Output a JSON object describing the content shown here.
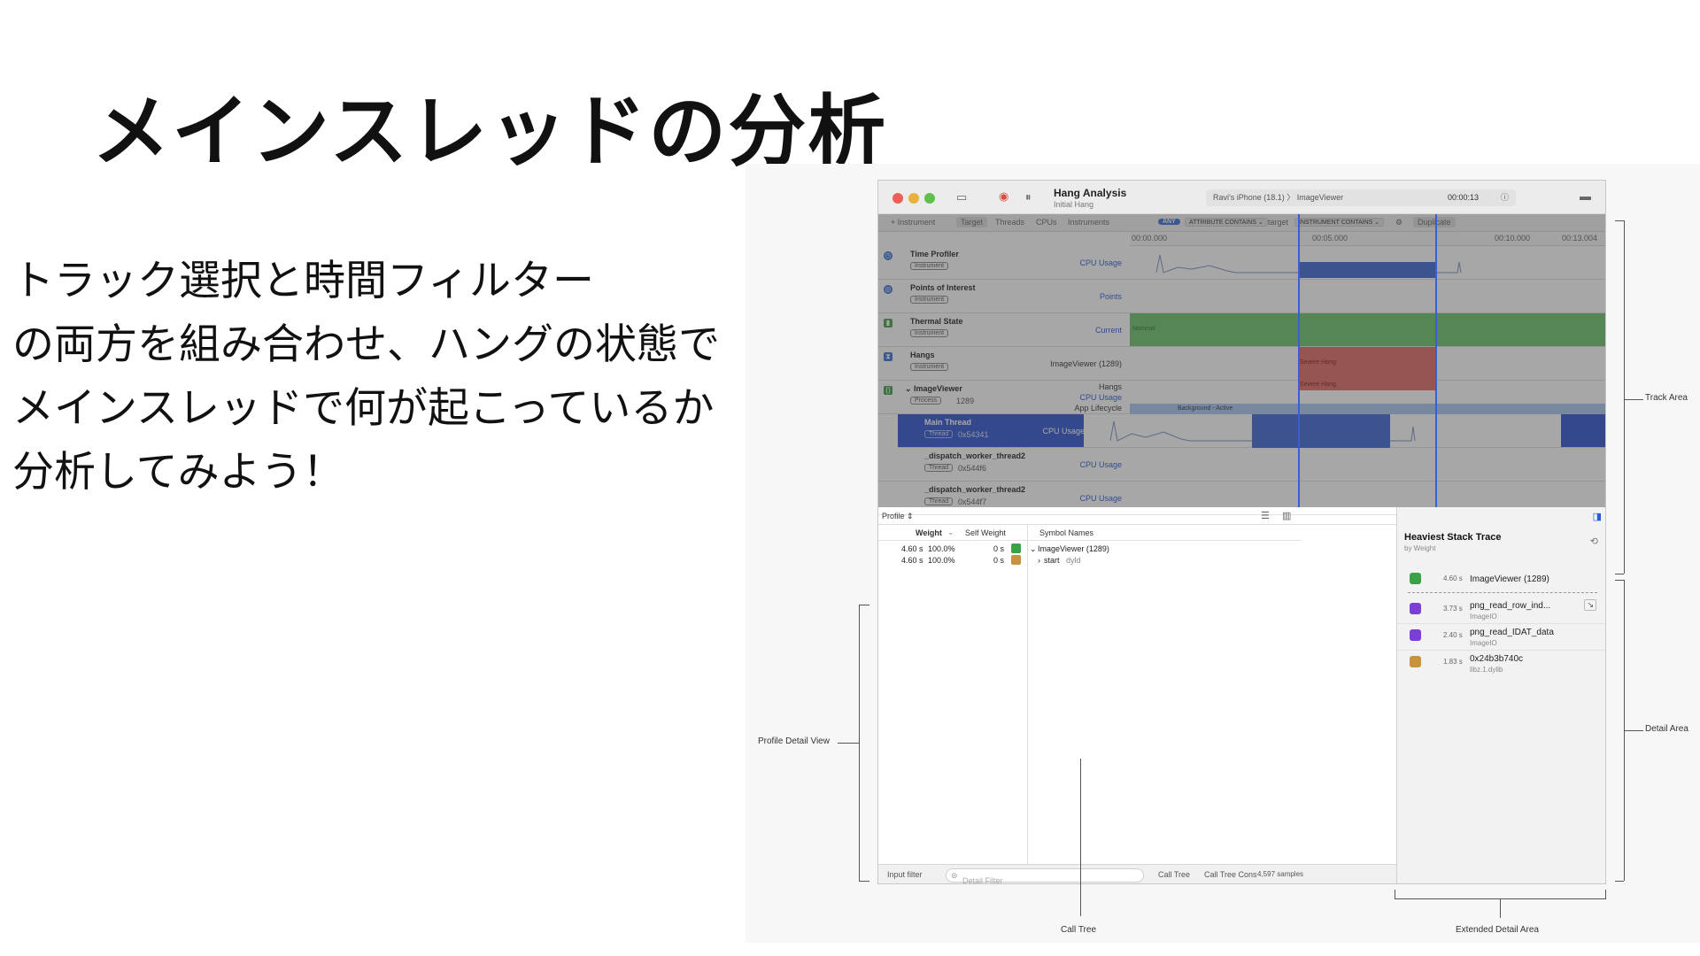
{
  "slide": {
    "title": "メインスレッドの分析",
    "body_lines": [
      "トラック選択と時間フィルター",
      "の両方を組み合わせ、ハングの状態で",
      "メインスレッドで何が起こっているか",
      "分析してみよう！"
    ]
  },
  "window": {
    "title": "Hang Analysis",
    "subtitle": "Initial Hang",
    "device": "Ravi's iPhone (18.1) 〉 ImageViewer",
    "elapsed": "00:00:13",
    "info_icon": "info-icon",
    "toolbar": {
      "add_instrument": "+ Instrument",
      "tabs": [
        "Target",
        "Threads",
        "CPUs",
        "Instruments"
      ],
      "filter_any": "ANY",
      "filter_attr": "ATTRIBUTE CONTAINS ⌄",
      "filter_target": "target",
      "filter_instr": "INSTRUMENT CONTAINS ⌄",
      "duplicate": "Duplicate"
    },
    "ruler": [
      "00:00.000",
      "00:05.000",
      "00:10.000",
      "00:13.004"
    ],
    "tracks": [
      {
        "name": "Time Profiler",
        "badge": "Instrument",
        "right": "CPU Usage"
      },
      {
        "name": "Points of Interest",
        "badge": "Instrument",
        "right": "Points"
      },
      {
        "name": "Thermal State",
        "badge": "Instrument",
        "right": "Current",
        "seg": "Nominal"
      },
      {
        "name": "Hangs",
        "badge": "Instrument",
        "right": "ImageViewer (1289)",
        "seg": "Severe Hang"
      },
      {
        "name": "ImageViewer",
        "badge": "Process",
        "pid": "1289",
        "right1": "Hangs",
        "right2": "CPU Usage",
        "right3": "App Lifecycle",
        "seg": "Severe Hang",
        "seg2": "Background - Active"
      },
      {
        "name": "Main Thread",
        "badge": "Thread",
        "pid": "0x54341",
        "right": "CPU Usage"
      },
      {
        "name": "_dispatch_worker_thread2",
        "badge": "Thread",
        "pid": "0x544f6",
        "right": "CPU Usage"
      },
      {
        "name": "_dispatch_worker_thread2",
        "badge": "Thread",
        "pid": "0x544f7",
        "right": "CPU Usage"
      }
    ],
    "profile": {
      "selector": "Profile ⇕",
      "columns": {
        "weight": "Weight",
        "self_weight": "Self Weight",
        "symbol": "Symbol Names"
      },
      "rows": [
        {
          "weight": "4.60 s",
          "pct": "100.0%",
          "self": "0 s",
          "symbol": "ImageViewer (1289)",
          "lib": ""
        },
        {
          "weight": "4.60 s",
          "pct": "100.0%",
          "self": "0 s",
          "symbol": "start",
          "lib": "dyld"
        }
      ],
      "footer": {
        "input_filter": "Input filter",
        "detail_filter_placeholder": "Detail Filter",
        "call_tree": "Call Tree",
        "call_tree_cons": "Call Tree Cons",
        "samples": "4,597 samples"
      }
    },
    "heaviest": {
      "title": "Heaviest Stack Trace",
      "subtitle": "by Weight",
      "frames": [
        {
          "time": "4.60 s",
          "name": "ImageViewer (1289)",
          "lib": "",
          "color": "#3aa146"
        },
        {
          "time": "3.73 s",
          "name": "png_read_row_ind...",
          "lib": "ImageIO",
          "color": "#7b3fd6"
        },
        {
          "time": "2.40 s",
          "name": "png_read_IDAT_data",
          "lib": "ImageIO",
          "color": "#7b3fd6"
        },
        {
          "time": "1.83 s",
          "name": "0x24b3b740c",
          "lib": "libz.1.dylib",
          "color": "#c9923f"
        }
      ]
    }
  },
  "annotations": {
    "track_area": "Track Area",
    "detail_area": "Detail Area",
    "profile_detail_view": "Profile Detail View",
    "call_tree": "Call Tree",
    "extended_detail_area": "Extended Detail Area"
  }
}
